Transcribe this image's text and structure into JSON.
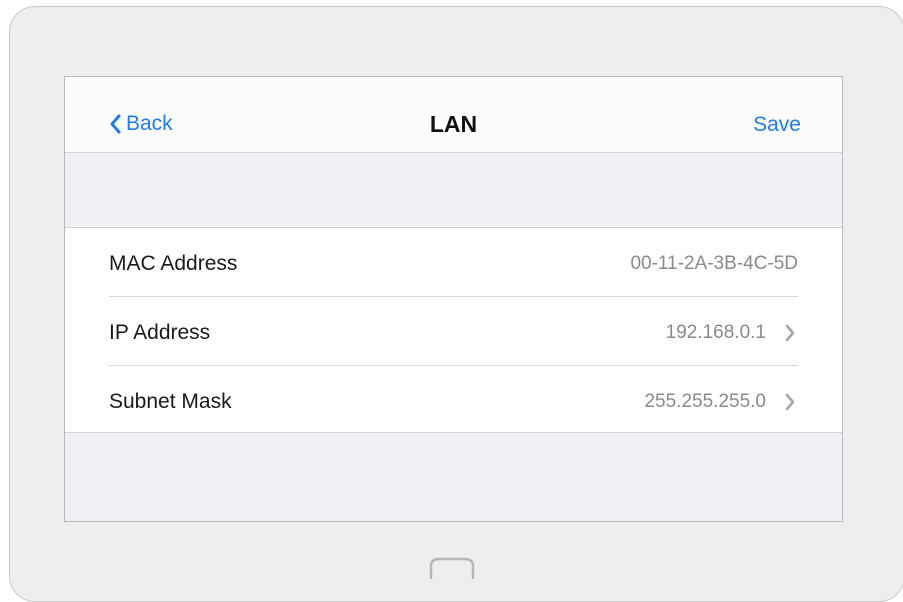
{
  "navbar": {
    "back_label": "Back",
    "title": "LAN",
    "save_label": "Save"
  },
  "rows": [
    {
      "label": "MAC Address",
      "value": "00-11-2A-3B-4C-5D",
      "has_chevron": false
    },
    {
      "label": "IP Address",
      "value": "192.168.0.1",
      "has_chevron": true
    },
    {
      "label": "Subnet Mask",
      "value": "255.255.255.0",
      "has_chevron": true
    }
  ],
  "icons": {
    "back": "chevron-left-icon",
    "row_disclosure": "chevron-right-icon",
    "home": "home-button-icon"
  },
  "colors": {
    "accent": "#1f7de6",
    "value_text": "#8a8a8e",
    "background": "#efeff4"
  }
}
